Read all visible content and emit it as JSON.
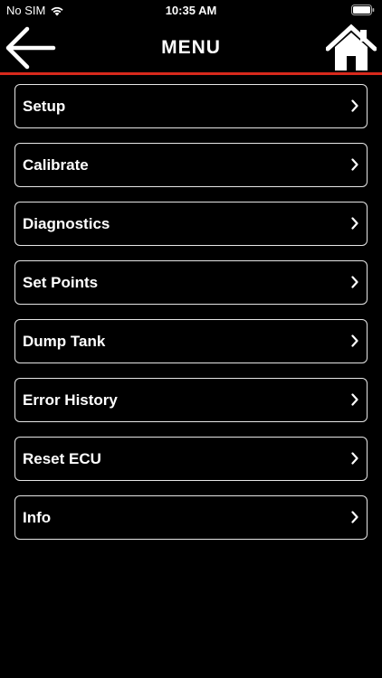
{
  "status_bar": {
    "carrier": "No SIM",
    "time": "10:35 AM",
    "icons": [
      "wifi-icon",
      "battery-icon"
    ]
  },
  "header": {
    "title": "MENU",
    "back_icon": "arrow-left-icon",
    "home_icon": "home-icon",
    "divider_color": "#d8291c"
  },
  "menu": {
    "items": [
      {
        "label": "Setup"
      },
      {
        "label": "Calibrate"
      },
      {
        "label": "Diagnostics"
      },
      {
        "label": "Set Points"
      },
      {
        "label": "Dump Tank"
      },
      {
        "label": "Error History"
      },
      {
        "label": "Reset ECU"
      },
      {
        "label": "Info"
      }
    ],
    "item_icon": "chevron-right-icon"
  }
}
